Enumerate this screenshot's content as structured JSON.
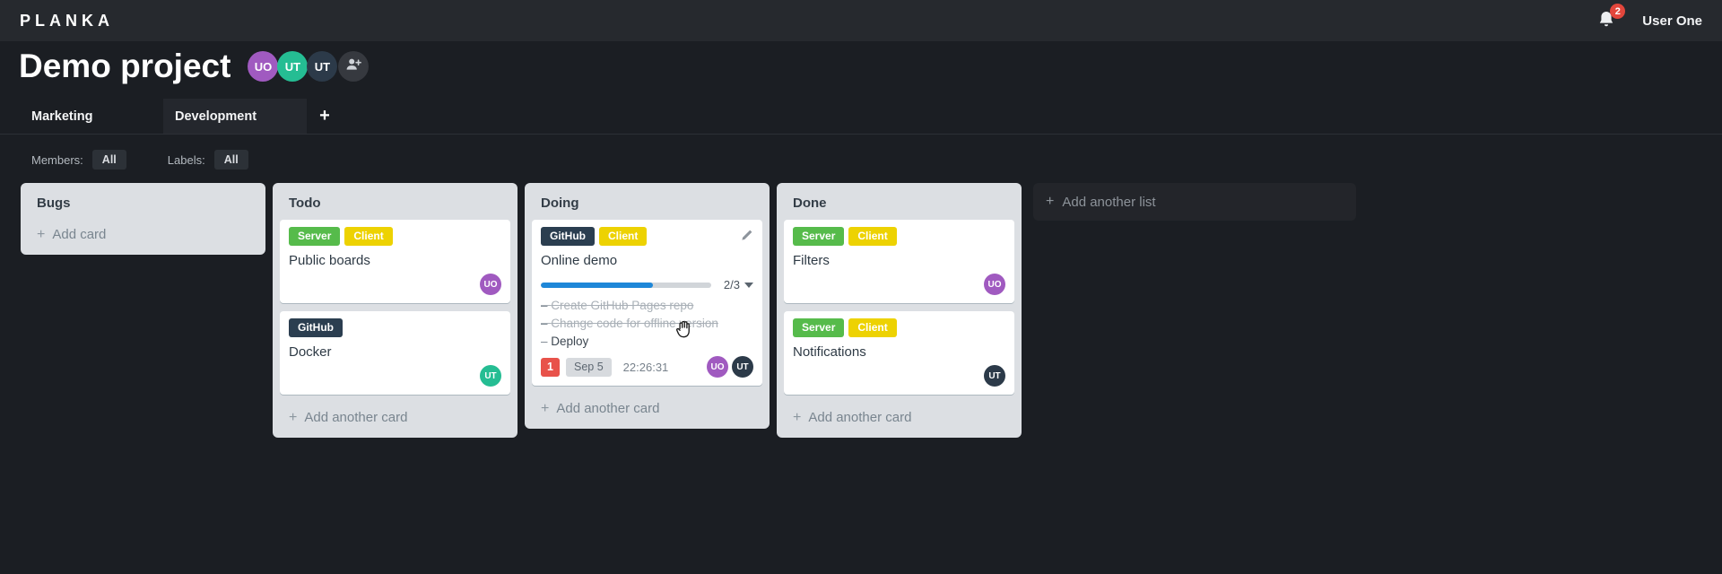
{
  "icons": {
    "plus": "+"
  },
  "topbar": {
    "logo": "PLANKA",
    "notification_count": "2",
    "user_name": "User One"
  },
  "project": {
    "title": "Demo project",
    "members": [
      {
        "initials": "UO",
        "color": "#a05ac0"
      },
      {
        "initials": "UT",
        "color": "#25bd93"
      },
      {
        "initials": "UT",
        "color": "#2c3a49"
      }
    ]
  },
  "tabs": {
    "items": [
      {
        "label": "Marketing"
      },
      {
        "label": "Development"
      }
    ]
  },
  "filters": {
    "members_label": "Members:",
    "members_value": "All",
    "labels_label": "Labels:",
    "labels_value": "All"
  },
  "board": {
    "add_card_label": "Add card",
    "add_another_card_label": "Add another card",
    "add_list_label": "Add another list",
    "lists": [
      {
        "title": "Bugs",
        "cards": []
      },
      {
        "title": "Todo",
        "cards": [
          {
            "title": "Public boards",
            "labels": [
              {
                "text": "Server",
                "color": "#56bb4b"
              },
              {
                "text": "Client",
                "color": "#edd202"
              }
            ],
            "members": [
              {
                "initials": "UO",
                "color": "#a05ac0"
              }
            ]
          },
          {
            "title": "Docker",
            "labels": [
              {
                "text": "GitHub",
                "color": "#2b3e50"
              }
            ],
            "members": [
              {
                "initials": "UT",
                "color": "#25bd93"
              }
            ]
          }
        ]
      },
      {
        "title": "Doing",
        "cards": [
          {
            "title": "Online demo",
            "labels": [
              {
                "text": "GitHub",
                "color": "#2b3e50"
              },
              {
                "text": "Client",
                "color": "#edd202"
              }
            ],
            "progress": {
              "summary": "2/3",
              "percent": "66%"
            },
            "tasks": [
              {
                "text": "Create GitHub Pages repo",
                "done": true
              },
              {
                "text": "Change code for offline version",
                "done": true
              },
              {
                "text": "Deploy",
                "done": false
              }
            ],
            "notification_count": "1",
            "due_date": "Sep 5",
            "timer": "22:26:31",
            "members": [
              {
                "initials": "UO",
                "color": "#a05ac0"
              },
              {
                "initials": "UT",
                "color": "#2c3a49"
              }
            ]
          }
        ]
      },
      {
        "title": "Done",
        "cards": [
          {
            "title": "Filters",
            "labels": [
              {
                "text": "Server",
                "color": "#56bb4b"
              },
              {
                "text": "Client",
                "color": "#edd202"
              }
            ],
            "members": [
              {
                "initials": "UO",
                "color": "#a05ac0"
              }
            ]
          },
          {
            "title": "Notifications",
            "labels": [
              {
                "text": "Server",
                "color": "#56bb4b"
              },
              {
                "text": "Client",
                "color": "#edd202"
              }
            ],
            "members": [
              {
                "initials": "UT",
                "color": "#2c3a49"
              }
            ]
          }
        ]
      }
    ]
  }
}
